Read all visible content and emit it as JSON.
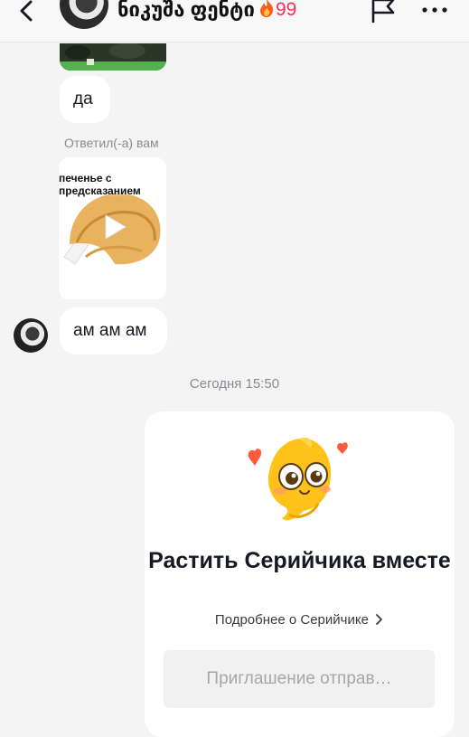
{
  "header": {
    "contact_name": "ნიკუშა ფენტი",
    "streak_count": "99",
    "icons": [
      "back-arrow-icon",
      "flame-icon",
      "flag-icon",
      "more-icon"
    ]
  },
  "messages": {
    "text_da": "да",
    "reply_label": "Ответил(-а) вам",
    "video_caption": "печенье с предсказанием",
    "text_am": "ам ам ам"
  },
  "timestamp": "Сегодня 15:50",
  "invite_card": {
    "title": "Растить Серийчика вместе",
    "link": "Подробнее о Серийчике",
    "button": "Приглашение отправ…"
  },
  "colors": {
    "accent": "#fe2c55",
    "background": "#f4f4f5",
    "bubble": "#ffffff"
  }
}
